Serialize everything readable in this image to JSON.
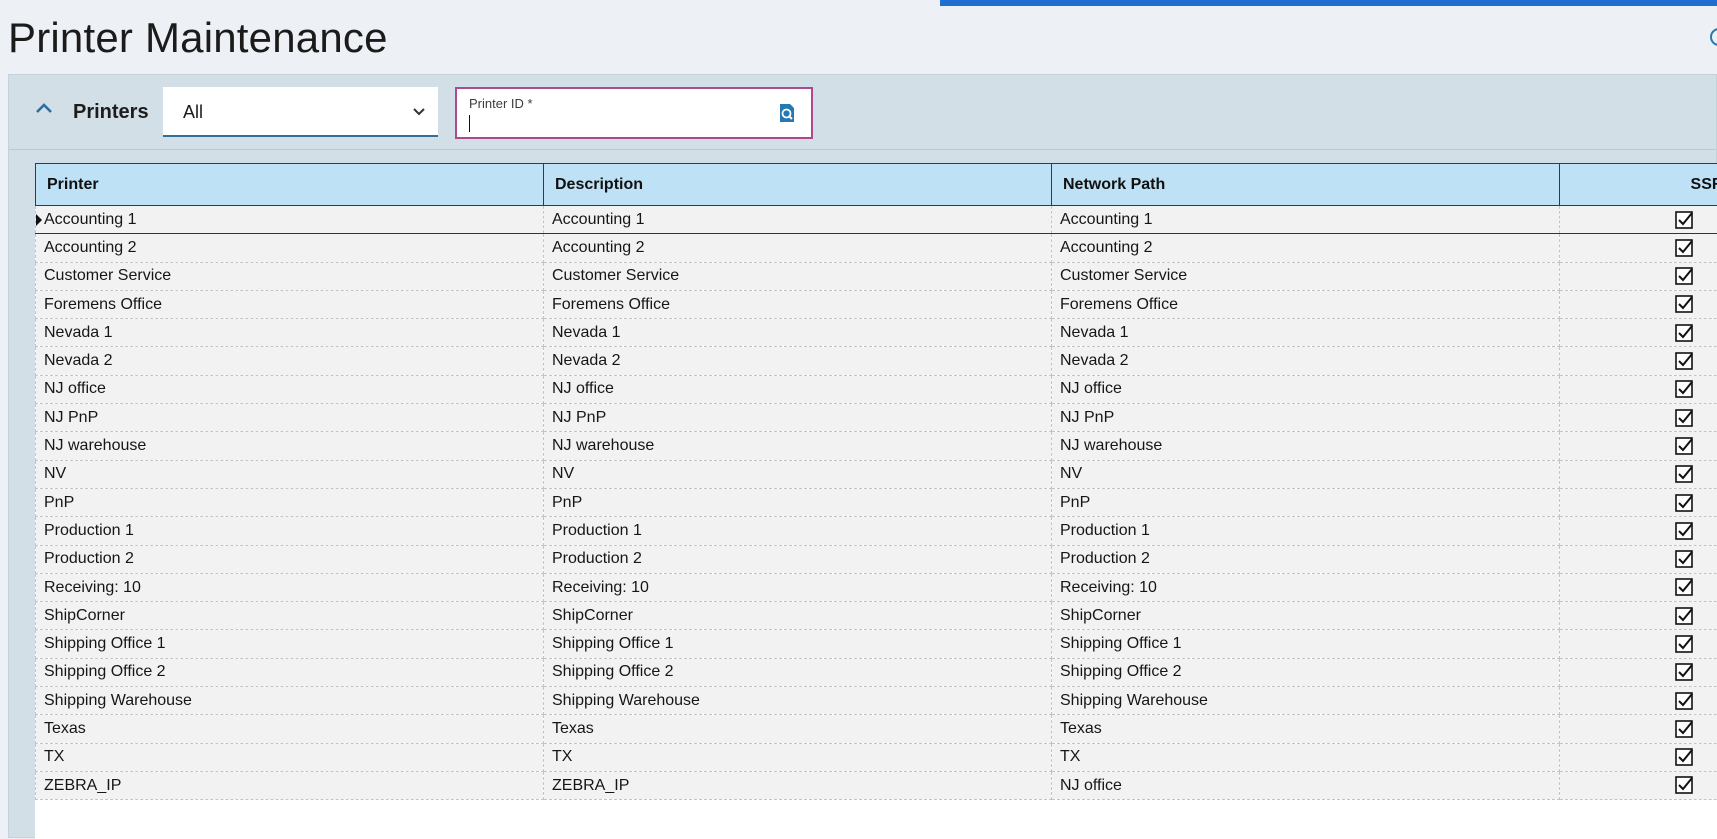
{
  "page": {
    "title": "Printer Maintenance"
  },
  "panel": {
    "label": "Printers",
    "filter": {
      "selected": "All"
    },
    "printer_id": {
      "label": "Printer ID *",
      "value": ""
    }
  },
  "grid": {
    "columns": [
      "Printer",
      "Description",
      "Network Path",
      "SSRS Print"
    ],
    "rows": [
      {
        "printer": "Accounting 1",
        "description": "Accounting 1",
        "path": "Accounting 1",
        "ssrs": true
      },
      {
        "printer": "Accounting 2",
        "description": "Accounting 2",
        "path": "Accounting 2",
        "ssrs": true
      },
      {
        "printer": "Customer Service",
        "description": "Customer Service",
        "path": "Customer Service",
        "ssrs": true
      },
      {
        "printer": "Foremens Office",
        "description": "Foremens Office",
        "path": "Foremens Office",
        "ssrs": true
      },
      {
        "printer": "Nevada 1",
        "description": "Nevada 1",
        "path": "Nevada 1",
        "ssrs": true
      },
      {
        "printer": "Nevada 2",
        "description": "Nevada 2",
        "path": "Nevada 2",
        "ssrs": true
      },
      {
        "printer": "NJ office",
        "description": "NJ office",
        "path": "NJ office",
        "ssrs": true
      },
      {
        "printer": "NJ PnP",
        "description": "NJ PnP",
        "path": "NJ PnP",
        "ssrs": true
      },
      {
        "printer": "NJ warehouse",
        "description": "NJ warehouse",
        "path": "NJ warehouse",
        "ssrs": true
      },
      {
        "printer": "NV",
        "description": "NV",
        "path": "NV",
        "ssrs": true
      },
      {
        "printer": "PnP",
        "description": "PnP",
        "path": "PnP",
        "ssrs": true
      },
      {
        "printer": "Production 1",
        "description": "Production 1",
        "path": "Production 1",
        "ssrs": true
      },
      {
        "printer": "Production 2",
        "description": "Production 2",
        "path": "Production 2",
        "ssrs": true
      },
      {
        "printer": "Receiving: 10",
        "description": "Receiving: 10",
        "path": "Receiving: 10",
        "ssrs": true
      },
      {
        "printer": "ShipCorner",
        "description": "ShipCorner",
        "path": "ShipCorner",
        "ssrs": true
      },
      {
        "printer": "Shipping Office 1",
        "description": "Shipping Office 1",
        "path": "Shipping Office 1",
        "ssrs": true
      },
      {
        "printer": "Shipping Office 2",
        "description": "Shipping Office 2",
        "path": "Shipping Office 2",
        "ssrs": true
      },
      {
        "printer": "Shipping Warehouse",
        "description": "Shipping Warehouse",
        "path": "Shipping Warehouse",
        "ssrs": true
      },
      {
        "printer": "Texas",
        "description": "Texas",
        "path": "Texas",
        "ssrs": true
      },
      {
        "printer": "TX",
        "description": "TX",
        "path": "TX",
        "ssrs": true
      },
      {
        "printer": "ZEBRA_IP",
        "description": "ZEBRA_IP",
        "path": "NJ office",
        "ssrs": true
      }
    ]
  },
  "colors": {
    "header_bg": "#bfe1f5",
    "link": "#2d6d9c",
    "panel_bg": "#d3dfe6",
    "field_border": "#b0488f",
    "banner": "#1f6fd1"
  },
  "icons": {
    "collapse": "chevron-up-icon",
    "dropdown": "chevron-down-icon",
    "search": "search-icon",
    "checkbox": "checkbox-checked-icon"
  }
}
